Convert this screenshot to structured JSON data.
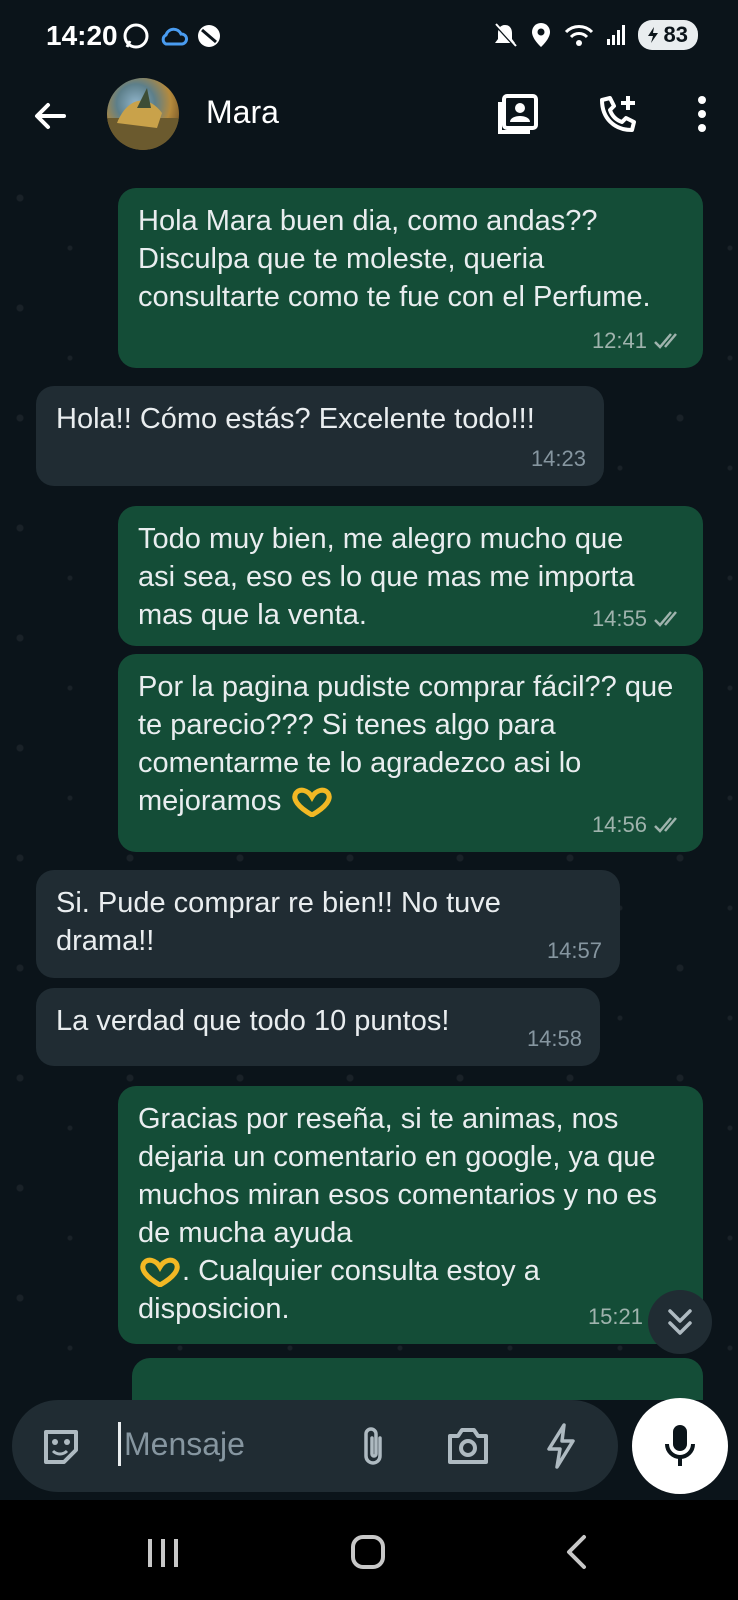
{
  "status_bar": {
    "time": "14:20",
    "battery": "83"
  },
  "header": {
    "contact_name": "Mara"
  },
  "messages": [
    {
      "direction": "out",
      "text": "Hola Mara buen dia, como andas?? Disculpa que te moleste, queria consultarte como te fue con el Perfume.",
      "time": "12:41"
    },
    {
      "direction": "in",
      "text": "Hola!! Cómo estás? Excelente todo!!!",
      "time": "14:23"
    },
    {
      "direction": "out",
      "text": "Todo muy bien, me alegro mucho que asi sea, eso es lo que mas me importa mas que la venta.",
      "time": "14:55"
    },
    {
      "direction": "out",
      "text": "Por la pagina pudiste comprar fácil?? que te parecio??? Si tenes algo para comentarme te lo agradezco asi lo mejoramos",
      "time": "14:56"
    },
    {
      "direction": "in",
      "text": "Si. Pude comprar re bien!! No tuve drama!!",
      "time": "14:57"
    },
    {
      "direction": "in",
      "text": "La verdad que todo 10 puntos!",
      "time": "14:58"
    },
    {
      "direction": "out",
      "text_before_emoji": "Gracias por reseña, si te animas, nos dejaria un comentario en google, ya que muchos miran esos comentarios y no es de mucha ayuda",
      "text_after_emoji": ". Cualquier consulta estoy a disposicion.",
      "time": "15:21"
    }
  ],
  "composer": {
    "placeholder": "Mensaje"
  },
  "colors": {
    "outgoing_bubble": "#144d37",
    "incoming_bubble": "#202c33",
    "background": "#0b141a"
  }
}
